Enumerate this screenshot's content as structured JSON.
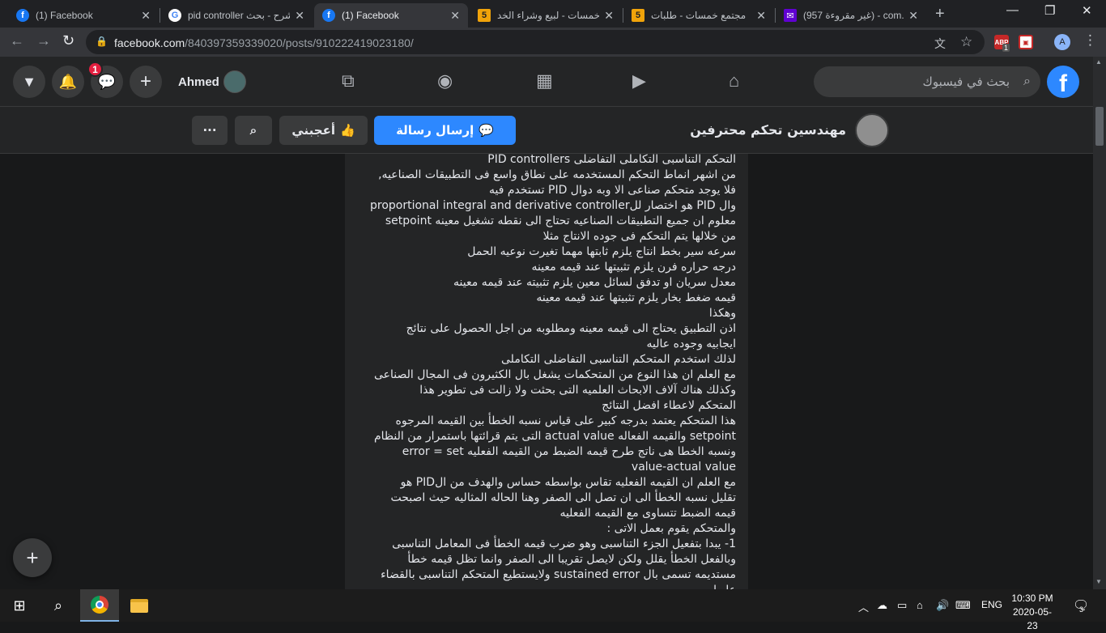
{
  "browser": {
    "tabs": [
      {
        "title": "(1) Facebook",
        "icon": "facebook-icon",
        "fav": "f"
      },
      {
        "title": "pid controller شرح - بحث",
        "icon": "google-icon",
        "fav": "G"
      },
      {
        "title": "(1) Facebook",
        "icon": "facebook-icon",
        "fav": "f"
      },
      {
        "title": "خمسات - لبيع وشراء الخد",
        "icon": "khamsat-icon",
        "fav": "5"
      },
      {
        "title": "مجتمع خمسات - طلبات",
        "icon": "khamsat-icon",
        "fav": "5"
      },
      {
        "title": "(957 غير مقروءة) - com.",
        "icon": "mail-icon",
        "fav": "✉"
      }
    ],
    "url_host": "facebook.com",
    "url_path": "/840397359339020/posts/910222419023180/",
    "ext_badge": "1"
  },
  "fbnav": {
    "username": "Ahmed",
    "messenger_badge": "1",
    "search_placeholder": "بحث في فيسبوك",
    "logo": "f"
  },
  "page": {
    "name": "مهندسين تحكم محترفين",
    "send_message": "إرسال رسالة",
    "like": "أعجبني",
    "more": "···"
  },
  "post_lines": [
    "التحكم التناسبى التكاملى التفاضلى PID controllers",
    "من اشهر انماط التحكم المستخدمه على نطاق واسع فى التطبيقات الصناعيه,",
    "فلا يوجد متحكم صناعى الا وبه دوال PID تستخدم فيه",
    "وال PID هو اختصار للproportional integral and derivative controller",
    "معلوم ان جميع التطبيقات الصناعيه تحتاج الى نقطه تشغيل معينه setpoint",
    "من خلالها يتم التحكم فى جوده الانتاج مثلا",
    "سرعه سير بخط انتاج يلزم ثابتها مهما تغيرت نوعيه الحمل",
    "درجه حراره فرن يلزم تثبيتها عند قيمه معينه",
    "معدل سريان او تدفق لسائل معين يلزم تثبيته عند قيمه معينه",
    "قيمه ضغط بخار يلزم تثبيتها عند قيمه معينه",
    "وهكذا",
    "اذن التطبيق يحتاج الى قيمه معينه ومطلوبه من اجل الحصول على نتائج",
    "ايجابيه وجوده عاليه",
    "لذلك استخدم المتحكم التناسبى التفاضلى التكاملى",
    "مع العلم ان هذا النوع من المتحكمات يشغل بال الكثيرون فى المجال الصناعى",
    "وكذلك هناك آلاف الابحاث العلميه التى بحثت ولا زالت فى تطوير هذا",
    "المتحكم لاعطاء افضل النتائج",
    "هذا المتحكم يعتمد بدرجه كبير على قياس نسبه الخطأ بين القيمه المرجوه",
    "setpoint والقيمه الفعاله actual value التى يتم قرائتها باستمرار من النظام",
    "ونسبه الخطا هى ناتج طرح قيمه الضبط من القيمه الفعليه  error = set",
    "value-actual value",
    "مع العلم ان القيمه الفعليه تقاس بواسطه حساس والهدف من الPID هو",
    "تقليل نسبه الخطأ الى ان تصل الى الصفر وهنا الحاله المثاليه حيث اصبحت",
    "قيمه الضبط تتساوى مع القيمه الفعليه",
    "والمتحكم يقوم بعمل الاتى :",
    "1- يبدا بتفعيل الجزء التناسبى وهو ضرب قيمه الخطأ فى المعامل التناسبى",
    "وبالفعل الخطأ يقلل ولكن لايصل تقريبا الى الصفر وانما تظل قيمه خطأ",
    "مستديمه تسمى بال sustained error ولايستطيع المتحكم التناسبى بالقضاء",
    "عليها"
  ],
  "taskbar": {
    "language": "ENG",
    "time": "10:30 PM",
    "date": "2020-05-23",
    "notifications": "3"
  }
}
